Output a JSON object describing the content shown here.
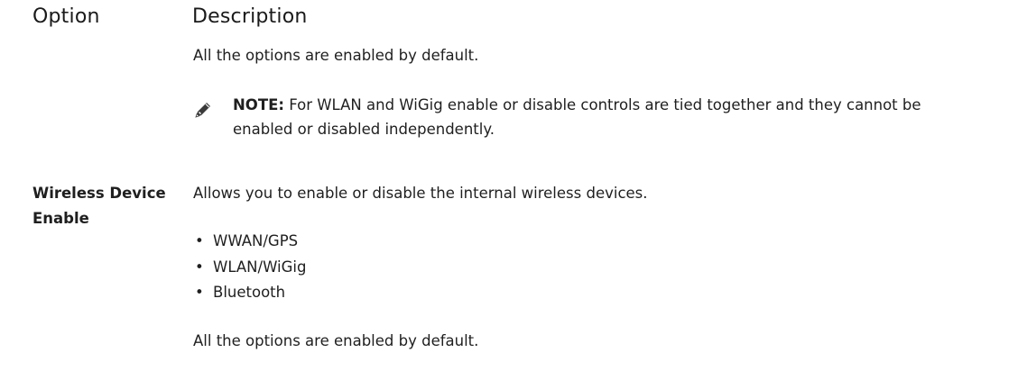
{
  "header": {
    "option_label": "Option",
    "description_label": "Description"
  },
  "intro_text": "All the options are enabled by default.",
  "note": {
    "icon": "pencil-note-icon",
    "label": "NOTE:",
    "text": "For WLAN and WiGig enable or disable controls are tied together and they cannot be enabled or disabled independently."
  },
  "option": {
    "name": "Wireless Device Enable",
    "description": "Allows you to enable or disable the internal wireless devices.",
    "items": [
      "WWAN/GPS",
      "WLAN/WiGig",
      "Bluetooth"
    ],
    "footer_text": "All the options are enabled by default."
  },
  "bullet_glyph": "•"
}
